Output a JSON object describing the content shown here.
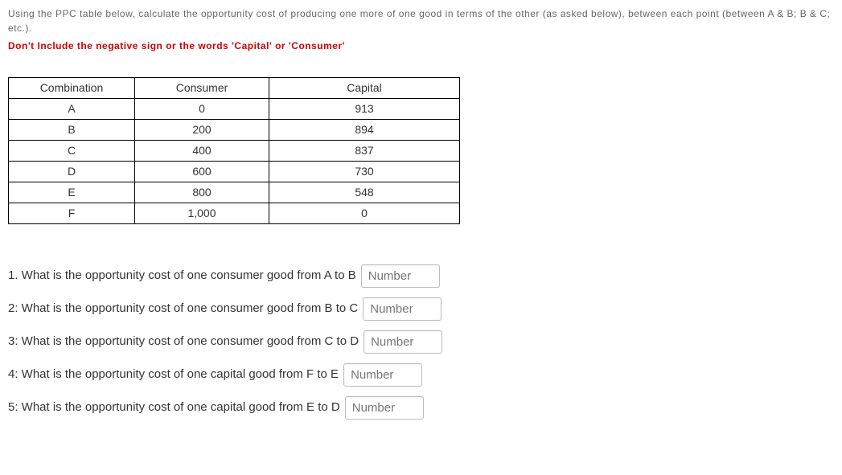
{
  "instructions": "Using the PPC table below, calculate the opportunity cost of producing one more of one good in terms of the other (as asked below), between each point (between A & B; B & C; etc.).",
  "warning": "Don't Include the negative sign or the words 'Capital' or 'Consumer'",
  "table": {
    "headers": {
      "combo": "Combination",
      "consumer": "Consumer",
      "capital": "Capital"
    },
    "rows": [
      {
        "combo": "A",
        "consumer": "0",
        "capital": "913"
      },
      {
        "combo": "B",
        "consumer": "200",
        "capital": "894"
      },
      {
        "combo": "C",
        "consumer": "400",
        "capital": "837"
      },
      {
        "combo": "D",
        "consumer": "600",
        "capital": "730"
      },
      {
        "combo": "E",
        "consumer": "800",
        "capital": "548"
      },
      {
        "combo": "F",
        "consumer": "1,000",
        "capital": "0"
      }
    ]
  },
  "questions": [
    {
      "text": "1.  What is the opportunity cost of one consumer good from A to B",
      "placeholder": "Number"
    },
    {
      "text": "2: What is the opportunity cost of one consumer good from B to C",
      "placeholder": "Number"
    },
    {
      "text": "3: What is the opportunity cost of one consumer good from C to D",
      "placeholder": "Number"
    },
    {
      "text": "4: What is the opportunity cost of one capital good from F to E",
      "placeholder": "Number"
    },
    {
      "text": "5: What is the opportunity cost of one capital good from E to D",
      "placeholder": "Number"
    }
  ]
}
